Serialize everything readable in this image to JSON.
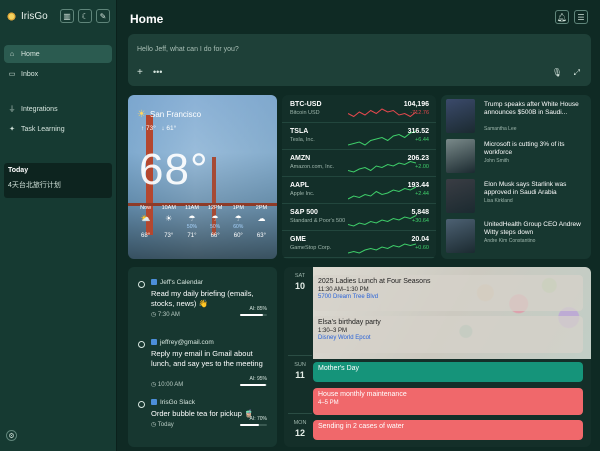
{
  "app": {
    "name": "IrisGo"
  },
  "sidebar": {
    "nav": [
      {
        "label": "Home",
        "icon": "home-icon",
        "active": true
      },
      {
        "label": "Inbox",
        "icon": "inbox-icon",
        "active": false
      },
      {
        "label": "Integrations",
        "icon": "plug-icon",
        "active": false
      },
      {
        "label": "Task Learning",
        "icon": "sparkle-icon",
        "active": false
      }
    ],
    "today": {
      "heading": "Today",
      "item": "4天台北旅行计划"
    }
  },
  "header": {
    "title": "Home"
  },
  "prompt": {
    "placeholder": "Hello Jeff, what can I do for you?"
  },
  "weather": {
    "city": "San Francisco",
    "high": "↑ 73°",
    "low": "↓ 61°",
    "temp": "68°",
    "hours": [
      {
        "label": "Now",
        "icon": "sun-cloud-icon",
        "glyph": "⛅",
        "precip": "",
        "temp": "68°"
      },
      {
        "label": "10AM",
        "icon": "sun-icon",
        "glyph": "☀",
        "precip": "",
        "temp": "73°"
      },
      {
        "label": "11AM",
        "icon": "rain-icon",
        "glyph": "☂",
        "precip": "50%",
        "temp": "71°"
      },
      {
        "label": "12PM",
        "icon": "rain-icon",
        "glyph": "☂",
        "precip": "50%",
        "temp": "66°"
      },
      {
        "label": "1PM",
        "icon": "rain-icon",
        "glyph": "☂",
        "precip": "60%",
        "temp": "60°"
      },
      {
        "label": "2PM",
        "icon": "cloud-icon",
        "glyph": "☁",
        "precip": "",
        "temp": "63°"
      }
    ]
  },
  "stocks": [
    {
      "symbol": "BTC-USD",
      "name": "Bitcoin USD",
      "price": "104,196",
      "change": "-712.76",
      "color": "#e5484d",
      "spark": [
        9,
        11,
        8,
        10,
        7,
        9,
        6,
        8,
        7,
        10,
        9,
        11,
        8
      ]
    },
    {
      "symbol": "TSLA",
      "name": "Tesla, Inc.",
      "price": "316.52",
      "change": "+6.44",
      "color": "#3fcf6a",
      "spark": [
        12,
        11,
        10,
        12,
        9,
        8,
        7,
        9,
        6,
        5,
        7,
        4,
        3
      ]
    },
    {
      "symbol": "AMZN",
      "name": "Amazon.com, Inc.",
      "price": "206.23",
      "change": "+2.00",
      "color": "#3fcf6a",
      "spark": [
        11,
        12,
        10,
        9,
        11,
        8,
        9,
        7,
        8,
        6,
        7,
        5,
        6
      ]
    },
    {
      "symbol": "AAPL",
      "name": "Apple Inc.",
      "price": "193.44",
      "change": "+2.44",
      "color": "#3fcf6a",
      "spark": [
        12,
        10,
        11,
        9,
        10,
        7,
        9,
        8,
        6,
        7,
        5,
        6,
        4
      ]
    },
    {
      "symbol": "S&P 500",
      "name": "Standard & Poor's 500",
      "price": "5,848",
      "change": "+30.64",
      "color": "#3fcf6a",
      "spark": [
        11,
        12,
        10,
        11,
        9,
        10,
        8,
        9,
        7,
        8,
        6,
        7,
        5
      ]
    },
    {
      "symbol": "GME",
      "name": "GameStop Corp.",
      "price": "20.04",
      "change": "+0.60",
      "color": "#3fcf6a",
      "spark": [
        12,
        11,
        12,
        10,
        9,
        10,
        8,
        9,
        7,
        8,
        6,
        7,
        6
      ]
    }
  ],
  "news": [
    {
      "title": "Trump speaks after White House announces $500B in Saudi...",
      "source": "Samantha Lee",
      "thumb": "#3b4a6b"
    },
    {
      "title": "Microsoft is cutting 3% of its workforce",
      "source": "John Smith",
      "thumb": "#7a8a8a"
    },
    {
      "title": "Elon Musk says Starlink was approved in Saudi Arabia",
      "source": "Lisa Kirkland",
      "thumb": "#3a3d44"
    },
    {
      "title": "UnitedHealth Group CEO Andrew Witty steps down",
      "source": "Andre Kim Constantino",
      "thumb": "#4d6173"
    }
  ],
  "tasks": [
    {
      "source": "Jeff's Calendar",
      "text": "Read my daily briefing (emails, stocks, news) 👋",
      "meta": "7:30 AM",
      "ai": "AI: 85%",
      "pct": 85
    },
    {
      "source": "jeffrey@gmail.com",
      "text": "Reply my email in Gmail about lunch, and say yes to the meeting",
      "meta": "10:00 AM",
      "ai": "AI: 95%",
      "pct": 95
    },
    {
      "source": "IrisGo Slack",
      "text": "Order bubble tea for pickup 🧋",
      "meta": "Today",
      "ai": "AI: 70%",
      "pct": 70
    }
  ],
  "calendar": {
    "days": [
      {
        "dow": "SAT",
        "num": "10"
      },
      {
        "dow": "SUN",
        "num": "11"
      },
      {
        "dow": "MON",
        "num": "12"
      }
    ],
    "events": [
      {
        "title": "2025 Ladies Lunch at Four Seasons",
        "time": "11:30 AM–1:30 PM",
        "location": "5700 Dream Tree Blvd",
        "bg": "rgba(214,210,201,0.75)",
        "fg": "#1e1e1e"
      },
      {
        "title": "Elsa's birthday party",
        "time": "1:30–3 PM",
        "location": "Disney World Epcot",
        "bg": "rgba(214,210,201,0.75)",
        "fg": "#1e1e1e"
      },
      {
        "title": "Mother's Day",
        "time": "",
        "location": "",
        "bg": "#15947a",
        "fg": "#ffffff"
      },
      {
        "title": "House monthly maintenance",
        "time": "4–5 PM",
        "location": "",
        "bg": "#f0686b",
        "fg": "#ffffff"
      },
      {
        "title": "Sending in 2 cases of water",
        "time": "",
        "location": "",
        "bg": "#f0686b",
        "fg": "#ffffff"
      }
    ]
  }
}
